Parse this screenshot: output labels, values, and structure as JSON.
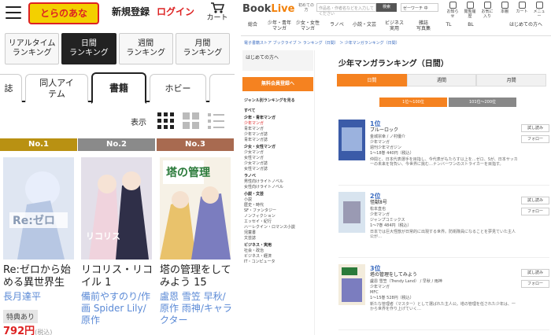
{
  "left": {
    "logo": "とらのあな",
    "signup": "新規登録",
    "login": "ログイン",
    "cart": "カート",
    "rank_tabs": [
      "リアルタイム\nランキング",
      "日間\nランキング",
      "週間\nランキング",
      "月間\nランキング"
    ],
    "genre_tabs": [
      "誌",
      "同人アイ\nテム",
      "書籍",
      "ホビー"
    ],
    "display_label": "表示",
    "columns": [
      {
        "badge": "No.1",
        "badge_color": "#b99112",
        "title": "Re:ゼロから始める異世界生",
        "author": "長月達平",
        "tokuten": "特典あり",
        "price": "792円",
        "tax": "(税込)"
      },
      {
        "badge": "No.2",
        "badge_color": "#8a8a8a",
        "title": "リコリス・リコイル 1",
        "author": "備前やすのり/作画 Spider Lily/原作",
        "tokuten": "",
        "price": "",
        "tax": ""
      },
      {
        "badge": "No.3",
        "badge_color": "#a86a50",
        "title": "塔の管理をしてみよう 15",
        "author": "盧恩 雪笠 早秋/原作 雨神/キャラクター",
        "tokuten": "",
        "price": "",
        "tax": ""
      }
    ]
  },
  "right": {
    "logo_a": "Book",
    "logo_b": "Live",
    "mini_labels": [
      "初めての方",
      "はじめての方へ"
    ],
    "search_placeholder": "作品名・作者名などを入力してください",
    "search_button": "検索",
    "search_select": "ゼーワーチ 中",
    "icons": [
      "お知らせ",
      "閲覧履歴",
      "お気に入り",
      "本棚",
      "カート",
      "メニュー"
    ],
    "nav": [
      "総合",
      "少年・青年\nマンガ",
      "少女・女性\nマンガ",
      "ラノベ",
      "小説・文芸",
      "ビジネス\n実用",
      "雑誌\n写真集",
      "TL",
      "BL",
      "はじめての方へ"
    ],
    "breadcrumb": "電子書籍ストア ブックライブ ＞ ランキング（日間） ＞ 少年マンガランキング（日間）",
    "welcome": "はじめての方へ",
    "free_signup": "無料会員登録へ",
    "side_title": "ジャンル別ランキングを見る",
    "side_items": [
      {
        "t": "すべて",
        "k": "head"
      },
      {
        "t": "少年・青年マンガ",
        "k": "head"
      },
      {
        "t": "少年マンガ",
        "k": "sel"
      },
      {
        "t": "青年マンガ",
        "k": ""
      },
      {
        "t": "少年マンガ誌",
        "k": ""
      },
      {
        "t": "青年マンガ誌",
        "k": ""
      },
      {
        "t": "少女・女性マンガ",
        "k": "head"
      },
      {
        "t": "少女マンガ",
        "k": ""
      },
      {
        "t": "女性マンガ",
        "k": ""
      },
      {
        "t": "少女マンガ誌",
        "k": ""
      },
      {
        "t": "女性マンガ誌",
        "k": ""
      },
      {
        "t": "ラノベ",
        "k": "head"
      },
      {
        "t": "男性向けライトノベル",
        "k": ""
      },
      {
        "t": "女性向けライトノベル",
        "k": ""
      },
      {
        "t": "小説・文芸",
        "k": "head"
      },
      {
        "t": "小説",
        "k": ""
      },
      {
        "t": "歴史・時代",
        "k": ""
      },
      {
        "t": "SF・ファンタジー",
        "k": ""
      },
      {
        "t": "ノンフィクション",
        "k": ""
      },
      {
        "t": "エッセイ・紀行",
        "k": ""
      },
      {
        "t": "ハーレクイン・ロマンス小説",
        "k": ""
      },
      {
        "t": "児童書",
        "k": ""
      },
      {
        "t": "文芸誌",
        "k": ""
      },
      {
        "t": "ビジネス・実用",
        "k": "head"
      },
      {
        "t": "社会・政治",
        "k": ""
      },
      {
        "t": "ビジネス・経済",
        "k": ""
      },
      {
        "t": "IT・コンピュータ",
        "k": ""
      }
    ],
    "title": "少年マンガランキング（日間）",
    "periods": [
      "日間",
      "週間",
      "月間"
    ],
    "ranges": [
      "1位〜100位",
      "101位〜200位"
    ],
    "items": [
      {
        "rank": "1位",
        "title": "ブルーロック",
        "author": "金城宗幸 / ノ村優介",
        "genre": "少年マンガ",
        "label": "週刊少年マガジン",
        "vol": "1〜18巻  440円（税込）",
        "comment": "仲間と、日本代表選手を目指し、今代表がもたらす以上を…ゼロ、Sが、日本サッカーの未来を背負い、今世界に挑む…ナンバーワンのストライカーを目指す。"
      },
      {
        "rank": "2位",
        "title": "怪獣8号",
        "author": "松本直也",
        "genre": "少年マンガ",
        "label": "ジャンプコミックス",
        "vol": "1〜7巻  484円（税込）",
        "comment": "日本では巨大怪獣が日常的に出現する世界。防衛隊員になることを夢見ていた主人公が…"
      },
      {
        "rank": "3位",
        "title": "塔の管理をしてみよう",
        "author": "盧恩 雪笠（Trendy Land） / 早秋 / 雨神",
        "genre": "少年マンガ",
        "label": "MFC",
        "vol": "1〜15巻  528円（税込）",
        "comment": "新たな管理者（マスター）として選ばれた主人公。塔の管理を任された少年は、一から世界を作り上げていく…"
      }
    ],
    "item_buttons": [
      "試し読み",
      "フォロー"
    ]
  }
}
